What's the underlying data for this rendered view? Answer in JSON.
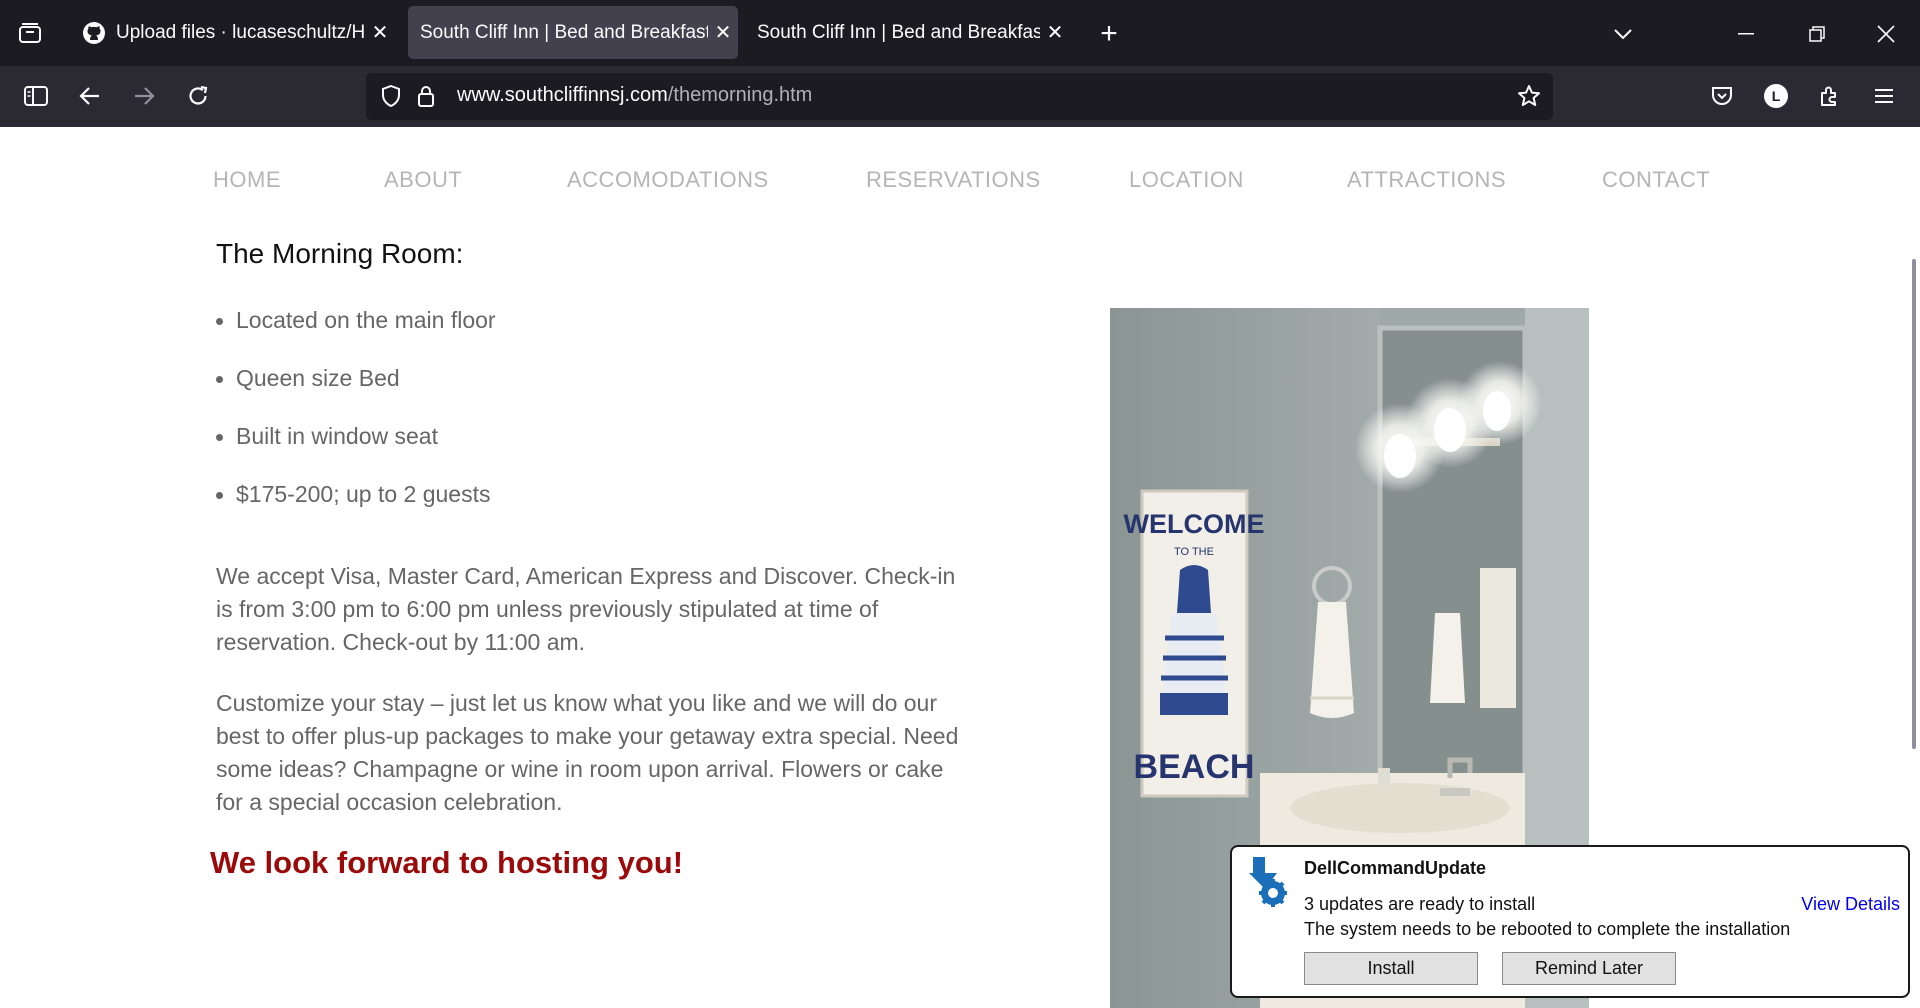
{
  "browser": {
    "tabs": [
      {
        "label": "Upload files · lucaseschultz/HTTP",
        "active": false
      },
      {
        "label": "South Cliff Inn | Bed and Breakfast |",
        "active": true
      },
      {
        "label": "South Cliff Inn | Bed and Breakfast |",
        "active": false
      }
    ],
    "url_domain": "www.southcliffinnsj.com",
    "url_path": "/themorning.htm",
    "profile_initial": "L"
  },
  "nav": {
    "items": [
      "HOME",
      "ABOUT",
      "ACCOMODATIONS",
      "RESERVATIONS",
      "LOCATION",
      "ATTRACTIONS",
      "CONTACT"
    ]
  },
  "room": {
    "title": "The Morning Room:",
    "features": [
      "Located on the main floor",
      "Queen size Bed",
      "Built in window seat",
      "$175-200; up to 2 guests"
    ],
    "payment_text": "We accept Visa, Master Card, American Express and Discover. Check-in is from 3:00 pm to 6:00 pm unless previously stipulated at time of reservation. Check-out by 11:00 am.",
    "customize_text": "Customize your stay – just let us know what you like and we will do our best to offer plus-up packages to make your getaway extra special. Need some ideas? Champagne or wine in room upon arrival. Flowers or cake for a special occasion celebration.",
    "closing": "We look forward to hosting you!"
  },
  "photo": {
    "sign_top": "WELCOME",
    "sign_mid": "TO THE",
    "sign_bottom": "BEACH"
  },
  "notification": {
    "app": "DellCommandUpdate",
    "line1": "3 updates are ready to install",
    "line2": "The system needs to be rebooted to complete the installation",
    "link": "View Details",
    "install": "Install",
    "remind": "Remind Later"
  },
  "colors": {
    "closing": "#9b0a0a",
    "nav_text": "#b5b5b5",
    "body_text": "#666666"
  }
}
